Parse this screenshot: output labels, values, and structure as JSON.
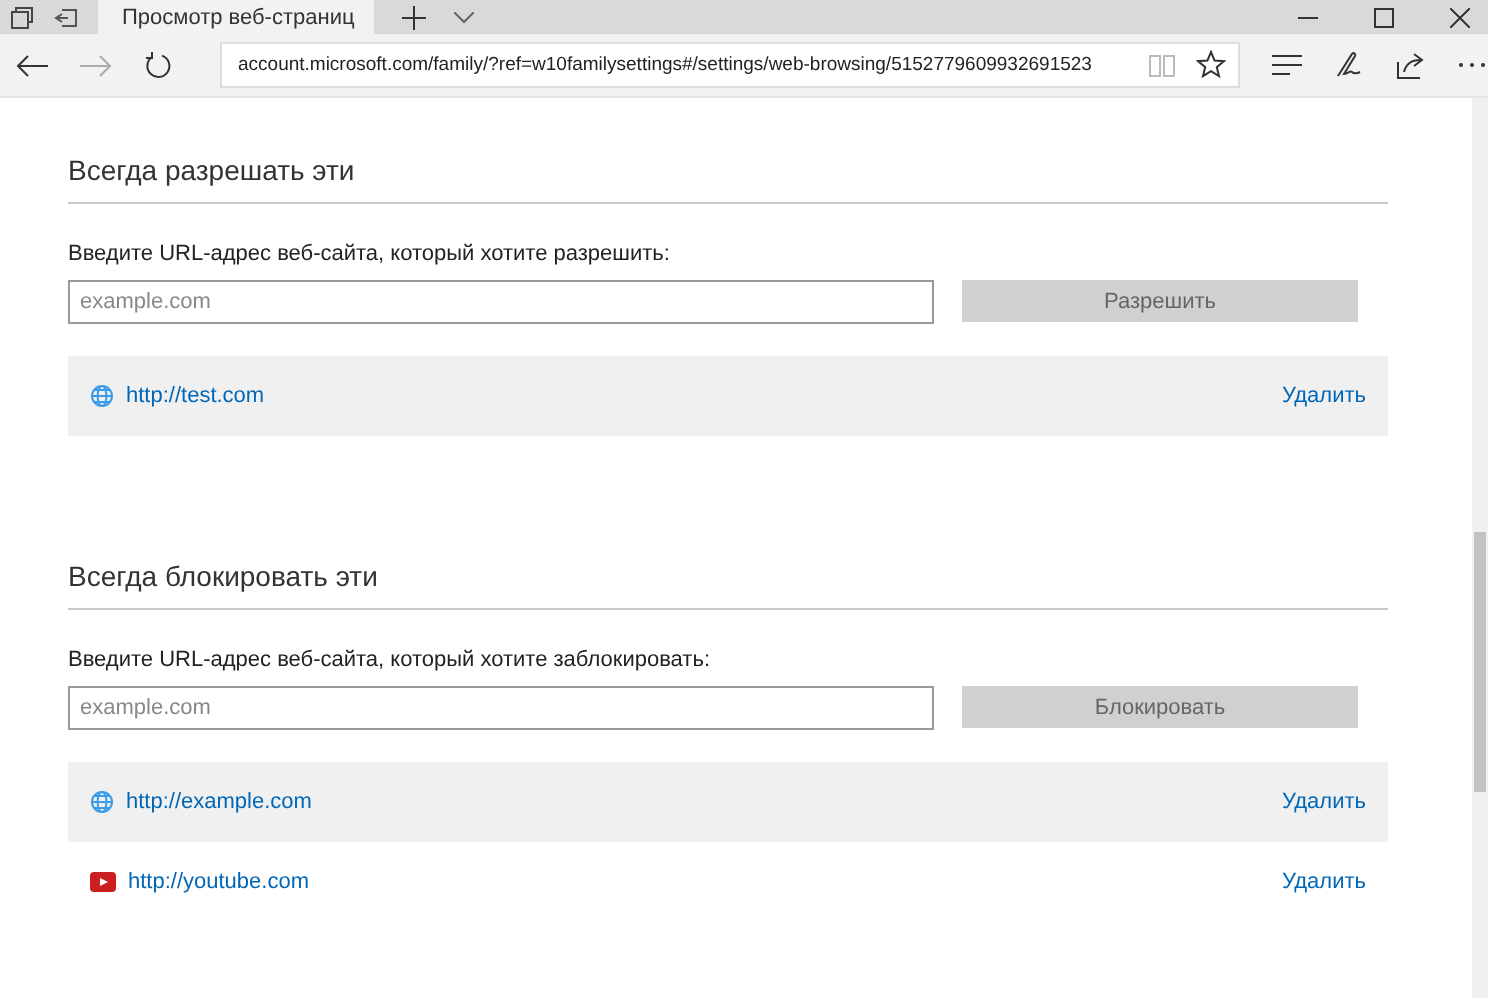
{
  "browser": {
    "tabs": [
      {
        "label": "Просмотр веб-страниц",
        "selected": true
      }
    ],
    "address": "account.microsoft.com/family/?ref=w10familysettings#/settings/web-browsing/5152779609932691523"
  },
  "sections": [
    {
      "title": "Всегда разрешать эти",
      "prompt": "Введите URL-адрес веб-сайта, который хотите разрешить:",
      "placeholder": "example.com",
      "button": {
        "label": "Разрешить",
        "disabled": true
      },
      "sites": [
        {
          "url": "http://test.com",
          "kind": "globe",
          "action": "Удалить"
        }
      ]
    },
    {
      "title": "Всегда блокировать эти",
      "prompt": "Введите URL-адрес веб-сайта, который хотите заблокировать:",
      "placeholder": "example.com",
      "button": {
        "label": "Блокировать",
        "disabled": true
      },
      "sites": [
        {
          "url": "http://example.com",
          "kind": "globe",
          "action": "Удалить"
        },
        {
          "url": "http://youtube.com",
          "kind": "video",
          "action": "Удалить"
        }
      ]
    }
  ]
}
